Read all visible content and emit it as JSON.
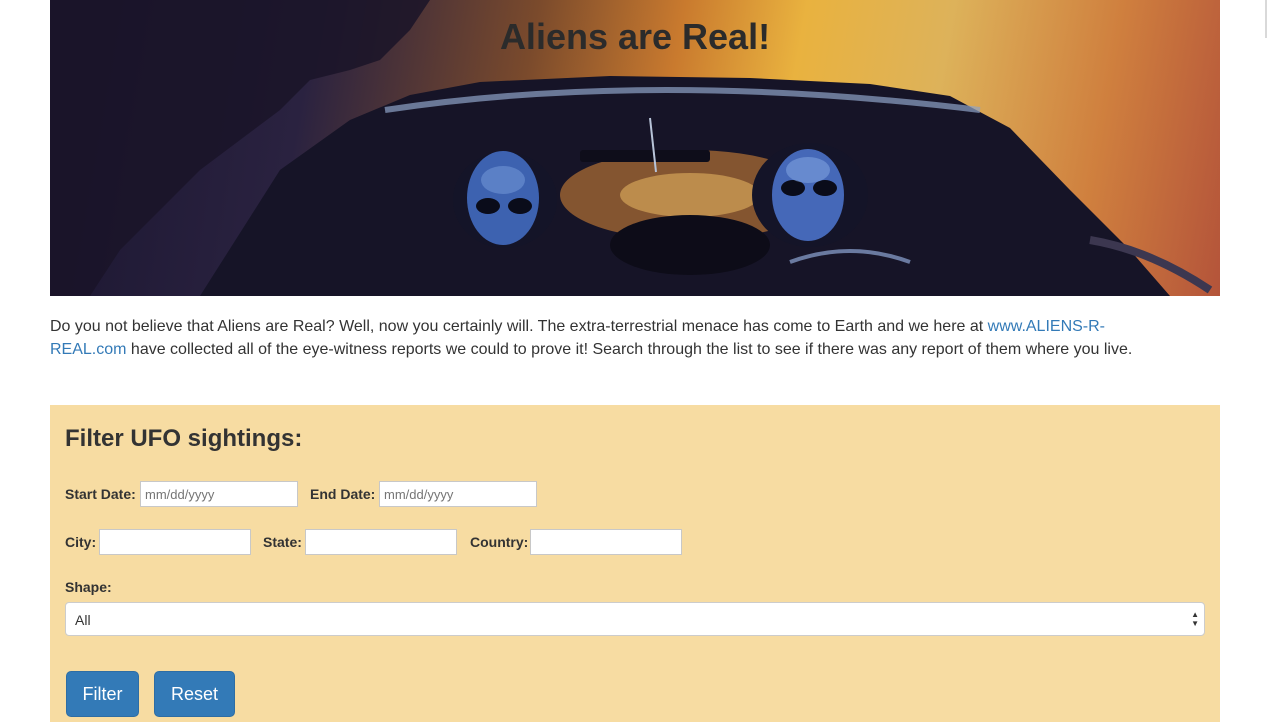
{
  "hero": {
    "title": "Aliens are Real!"
  },
  "intro": {
    "text_before": "Do you not believe that Aliens are Real? Well, now you certainly will. The extra-terrestrial menace has come to Earth and we here at ",
    "link_text": "www.ALIENS-R-REAL.com",
    "text_after": " have collected all of the eye-witness reports we could to prove it! Search through the list to see if there was any report of them where you live."
  },
  "filter": {
    "title": "Filter UFO sightings:",
    "start_date_label": "Start Date:",
    "start_date_placeholder": "mm/dd/yyyy",
    "end_date_label": "End Date:",
    "end_date_placeholder": "mm/dd/yyyy",
    "city_label": "City:",
    "city_value": "",
    "state_label": "State:",
    "state_value": "",
    "country_label": "Country:",
    "country_value": "",
    "shape_label": "Shape:",
    "shape_selected": "All",
    "filter_button": "Filter",
    "reset_button": "Reset"
  },
  "colors": {
    "panel_bg": "#f7dca2",
    "button_bg": "#337ab7",
    "link": "#337ab7"
  }
}
